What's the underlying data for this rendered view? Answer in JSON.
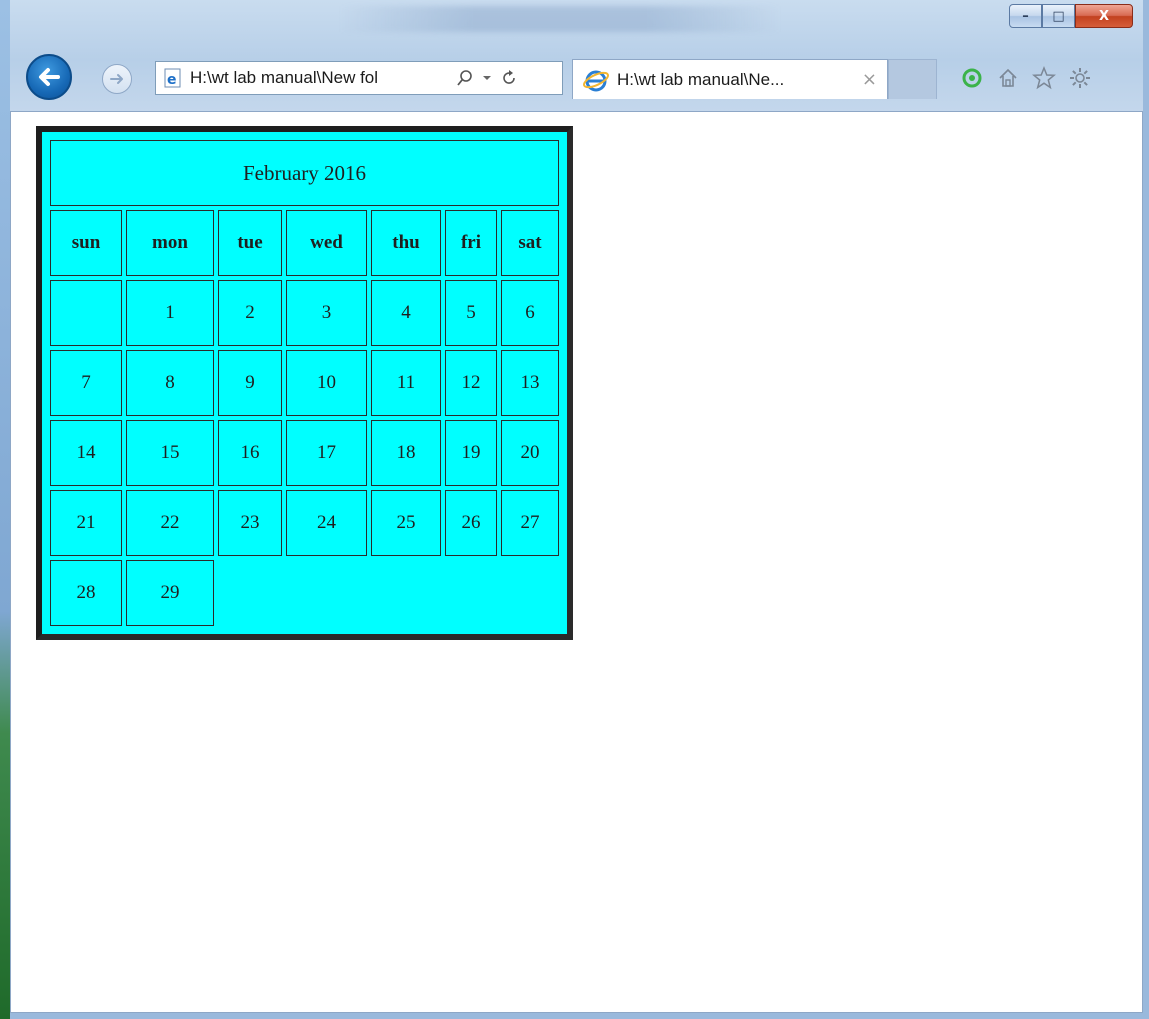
{
  "browser": {
    "address": "H:\\wt lab manual\\New fol",
    "tab_title": "H:\\wt lab manual\\Ne...",
    "tab_close": "×",
    "caption": {
      "minimize": "–",
      "maximize": "□",
      "close": "X"
    }
  },
  "calendar": {
    "title": "February 2016",
    "days": [
      "sun",
      "mon",
      "tue",
      "wed",
      "thu",
      "fri",
      "sat"
    ],
    "weeks": [
      [
        "",
        "1",
        "2",
        "3",
        "4",
        "5",
        "6"
      ],
      [
        "7",
        "8",
        "9",
        "10",
        "11",
        "12",
        "13"
      ],
      [
        "14",
        "15",
        "16",
        "17",
        "18",
        "19",
        "20"
      ],
      [
        "21",
        "22",
        "23",
        "24",
        "25",
        "26",
        "27"
      ],
      [
        "28",
        "29"
      ]
    ],
    "colors": {
      "cell_bg": "#00ffff",
      "frame": "#1e1e1e",
      "text": "#1f1f1f"
    }
  },
  "icons": {
    "back": "back-arrow-icon",
    "forward": "forward-arrow-icon",
    "page": "ie-page-icon",
    "search": "search-icon",
    "dropdown": "chevron-down-icon",
    "refresh": "refresh-icon",
    "ie": "ie-logo-icon",
    "feed": "feed-icon",
    "home": "home-icon",
    "favorites": "star-icon",
    "tools": "gear-icon"
  }
}
